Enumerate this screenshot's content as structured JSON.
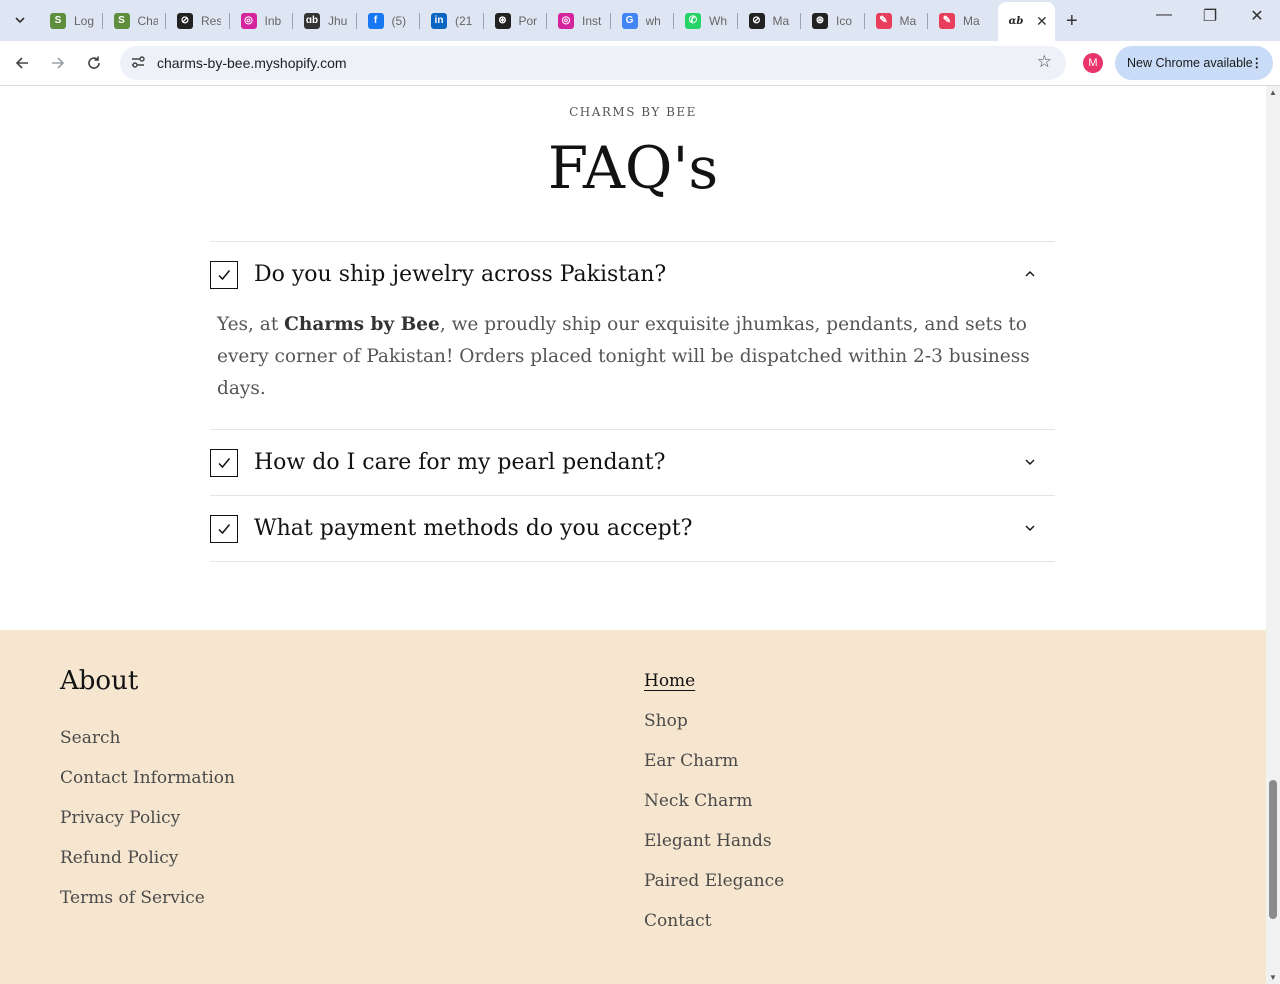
{
  "browser": {
    "tabs": [
      {
        "title": "Log",
        "icon": "shopify-icon",
        "color": "#5e8e3e"
      },
      {
        "title": "Cha",
        "icon": "shopify-icon",
        "color": "#5e8e3e"
      },
      {
        "title": "Res",
        "icon": "openai-icon",
        "color": "#222222"
      },
      {
        "title": "Inb",
        "icon": "instagram-icon",
        "color": "#d6249f"
      },
      {
        "title": "Jhu",
        "icon": "charms-icon",
        "color": "#333333"
      },
      {
        "title": "(5)",
        "icon": "facebook-icon",
        "color": "#1877f2"
      },
      {
        "title": "(21",
        "icon": "linkedin-icon",
        "color": "#0a66c2"
      },
      {
        "title": "Por",
        "icon": "chatgpt-icon",
        "color": "#222222"
      },
      {
        "title": "Inst",
        "icon": "instagram-icon",
        "color": "#d6249f"
      },
      {
        "title": "wh",
        "icon": "google-icon",
        "color": "#4285f4"
      },
      {
        "title": "Wh",
        "icon": "whatsapp-icon",
        "color": "#25d366"
      },
      {
        "title": "Ma",
        "icon": "openai-icon",
        "color": "#222222"
      },
      {
        "title": "Ico",
        "icon": "chatgpt-icon",
        "color": "#222222"
      },
      {
        "title": "Ma",
        "icon": "pen-icon",
        "color": "#e83e5c"
      },
      {
        "title": "Ma",
        "icon": "pen-icon",
        "color": "#e83e5c"
      }
    ],
    "active_tab": {
      "title": "",
      "icon": "charms-icon"
    },
    "url": "charms-by-bee.myshopify.com",
    "profile_initial": "M",
    "update_label": "New Chrome available"
  },
  "faq": {
    "eyebrow": "CHARMS BY BEE",
    "title": "FAQ's",
    "items": [
      {
        "question": "Do you ship jewelry across Pakistan?",
        "expanded": true,
        "answer_pre": "Yes, at ",
        "answer_bold": "Charms by Bee",
        "answer_post": ", we proudly ship our exquisite jhumkas, pendants, and sets to every corner of Pakistan! Orders placed tonight will be dispatched within 2-3 business days."
      },
      {
        "question": "How do I care for my pearl pendant?",
        "expanded": false
      },
      {
        "question": "What payment methods do you accept?",
        "expanded": false
      }
    ]
  },
  "footer": {
    "about_heading": "About",
    "about_links": [
      "Search",
      "Contact Information",
      "Privacy Policy",
      "Refund Policy",
      "Terms of Service"
    ],
    "menu_links": [
      "Home",
      "Shop",
      "Ear Charm",
      "Neck Charm",
      "Elegant Hands",
      "Paired Elegance",
      "Contact"
    ],
    "active_menu": "Home",
    "background": "#f6e6cf"
  }
}
